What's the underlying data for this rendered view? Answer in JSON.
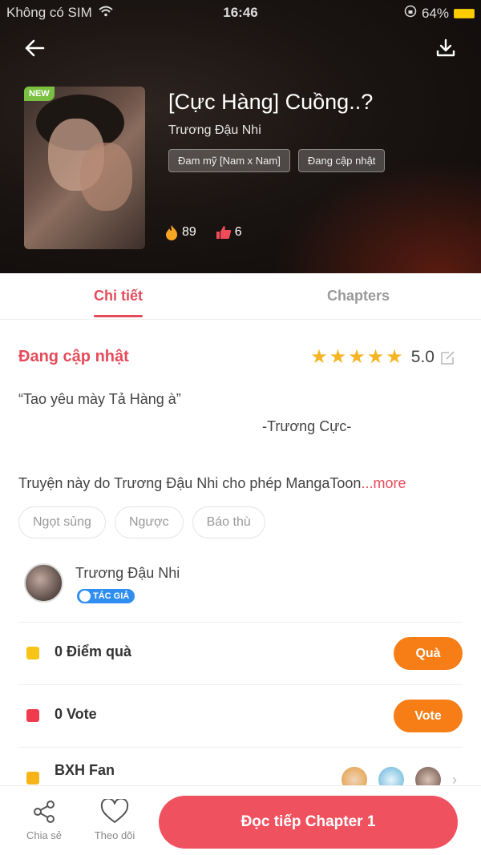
{
  "status_bar": {
    "carrier": "Không có SIM",
    "time": "16:46",
    "battery": "64%"
  },
  "header": {
    "back_icon": "arrow-left-icon",
    "download_icon": "download-icon",
    "badge": "NEW",
    "title": "[Cực Hàng] Cuồng..?",
    "author": "Trương Đậu Nhi",
    "tags": [
      "Đam mỹ [Nam x Nam]",
      "Đang cập nhật"
    ],
    "views": "89",
    "likes": "6"
  },
  "tabs": [
    {
      "label": "Chi tiết",
      "active": true
    },
    {
      "label": "Chapters",
      "active": false
    }
  ],
  "detail": {
    "status": "Đang cập nhật",
    "rating": "5.0",
    "stars": 5,
    "quote": "“Tao yêu mày Tả Hàng à”",
    "signature": "-Trương Cực-",
    "description": "Truyện này do Trương Đậu Nhi cho phép MangaToon",
    "more": "...more",
    "genres": [
      "Ngọt sủng",
      "Ngược",
      "Báo thù"
    ]
  },
  "author_section": {
    "name": "Trương Đậu Nhi",
    "badge": "TÁC GIẢ"
  },
  "gift_row": {
    "label": "0 Điểm quà",
    "button": "Quà"
  },
  "vote_row": {
    "label": "0 Vote",
    "button": "Vote"
  },
  "fan_row": {
    "label": "BXH Fan"
  },
  "bottom_bar": {
    "share_label": "Chia sẻ",
    "follow_label": "Theo dõi",
    "read_button": "Đọc tiếp Chapter 1"
  },
  "colors": {
    "accent": "#e54b5a",
    "orange": "#f77e17",
    "star": "#f5b423",
    "read_button": "#f0515f"
  }
}
